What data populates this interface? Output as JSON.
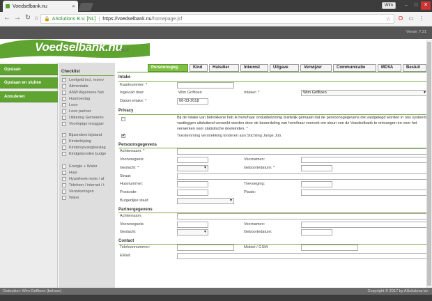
{
  "browser": {
    "tab_title": "Voedselbank.nu",
    "window_user": "Wim",
    "org": "ASolutions B.V. [NL]",
    "url_host": "https://voedselbank.nu",
    "url_path": "/homepage.jsf",
    "colors": {
      "chrome": "#3c3c3c",
      "accent": "#5fa331"
    }
  },
  "header": {
    "version": "Versie: 7.21",
    "logo": "Voedselbank.nu",
    "help": "HELP"
  },
  "sidebar": {
    "buttons": [
      "Opslaan",
      "Opslaan en sluiten",
      "Annuleren"
    ]
  },
  "checklist": {
    "title": "Checklist",
    "group1": [
      "Leefgeld incl. reserv",
      "Alimentatie",
      "ANW Algemene Nat",
      "Huurtoeslag",
      "Loon",
      "Loon partner",
      "Uitkering Gemeente",
      "Voorlopige teruggav"
    ],
    "group2": [
      "Bijzondere bijstand",
      "Kinderbijslag",
      "Kinderopvangtoeslag",
      "Kindgebonden budge"
    ],
    "group3": [
      "Energie + Water",
      "Huur",
      "Hypotheek rente / af",
      "Telefoon / internet / t",
      "Verzekeringen",
      "Water"
    ]
  },
  "tabs": [
    "Persoonsgeg.",
    "Kind",
    "Huisdier",
    "Inkomst",
    "Uitgave",
    "Verwijzer",
    "Communicatie",
    "MDVA",
    "Besluit"
  ],
  "intake": {
    "title": "Intake",
    "kaartnummer_label": "Kaartnummer: *",
    "kaartnummer_value": "",
    "ingevuld_label": "Ingevuld door:",
    "ingevuld_value": "Wim Griffioen",
    "intaker_label": "Intaker: *",
    "intaker_value": "Wim Griffioen",
    "datum_label": "Datum intake: *",
    "datum_value": "06-03-2018"
  },
  "privacy": {
    "title": "Privacy",
    "text": "Bij de intake van betrokkene heb ik hem/haar ondubbelzinnig duidelijk gemaakt dat de persoonsgegevens die vastgelegd worden in ons systeem vastleggen uitsluitend verwerkt worden door de beoordeling van hem/haar verzoek om steun van de Voedselbank te ontvangen en voor het verwerken voor statistische doeleinden. *",
    "consent_text": "Toestemming verstrekking kinderen aan Stichting Jarige Job.",
    "privacy_checked": false,
    "consent_checked": true
  },
  "persoonsgegevens": {
    "title": "Persoonsgegevens",
    "achternaam": "Achternaam: *",
    "voorvoegsels": "Voorvoegsels:",
    "voornamen": "Voornamen:",
    "geslacht": "Geslacht: *",
    "geboortedatum": "Geboortedatum: *",
    "straat": "Straat:",
    "huisnummer": "Huisnummer:",
    "toevoeging": "Toevoeging:",
    "postcode": "Postcode:",
    "plaats": "Plaats:",
    "burgerlijke": "Burgerlijke staat:"
  },
  "partnergegevens": {
    "title": "Partnergegevens",
    "achternaam": "Achternaam:",
    "voorvoegsels": "Voorvoegsels:",
    "voornamen": "Voornamen:",
    "geslacht": "Geslacht:",
    "geboortedatum": "Geboortedatum:"
  },
  "contact": {
    "title": "Contact",
    "telefoon": "Telefoonnummer:",
    "mobiel": "Mobiel / GSM:",
    "email": "EMail:"
  },
  "footer": {
    "user": "Gebruiker: Wim Griffioen (beheer)",
    "copyright": "Copyright © 2017 by ASolutions bv"
  }
}
